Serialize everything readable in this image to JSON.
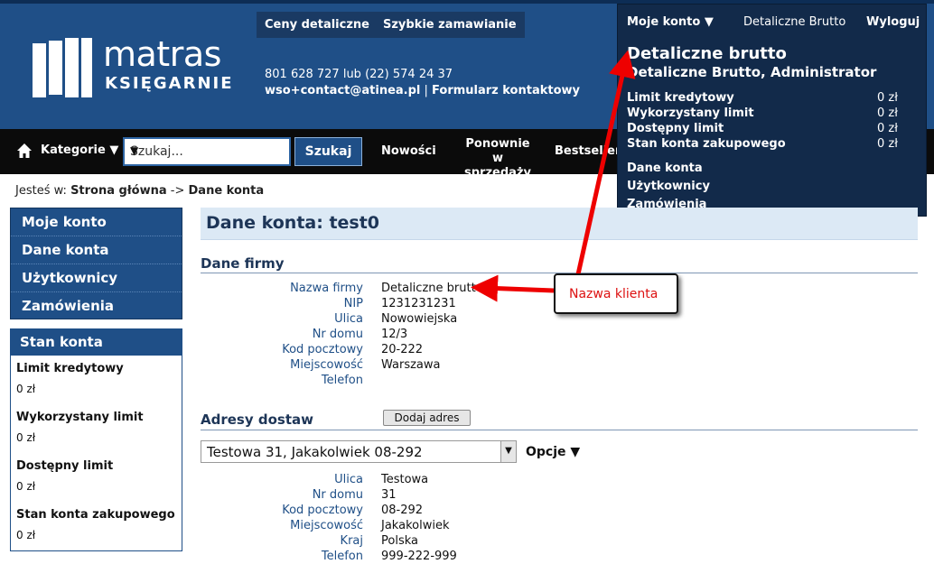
{
  "logo": {
    "brand": "matras",
    "sub": "KSIĘGARNIE"
  },
  "top_buttons": {
    "retail": "Ceny detaliczne",
    "quick": "Szybkie zamawianie"
  },
  "contact": {
    "phones": "801 628 727 lub (22) 574 24 37",
    "email": "wso+contact@atinea.pl",
    "separator": "|",
    "form": "Formularz kontaktowy"
  },
  "nav": {
    "categories": "Kategorie ▼",
    "search_placeholder": "Szukaj...",
    "search_button": "Szukaj",
    "new": "Nowości",
    "again_line1": "Ponownie",
    "again_line2": "w sprzedaży",
    "bestsellers": "Bestsellery"
  },
  "account": {
    "menu_label": "Moje konto ▼",
    "user_short": "Detaliczne Brutto",
    "logout": "Wyloguj",
    "company": "Detaliczne brutto",
    "role": "Detaliczne Brutto, Administrator",
    "rows": [
      {
        "label": "Limit kredytowy",
        "value": "0 zł"
      },
      {
        "label": "Wykorzystany limit",
        "value": "0 zł"
      },
      {
        "label": "Dostępny limit",
        "value": "0 zł"
      },
      {
        "label": "Stan konta zakupowego",
        "value": "0 zł"
      }
    ],
    "links": [
      "Dane konta",
      "Użytkownicy",
      "Zamówienia"
    ]
  },
  "breadcrumb": {
    "prefix": "Jesteś w:",
    "home": "Strona główna",
    "sep": "->",
    "current": "Dane konta"
  },
  "sidebar": {
    "items": [
      "Moje konto",
      "Dane konta",
      "Użytkownicy",
      "Zamówienia"
    ],
    "balance_title": "Stan konta",
    "balance": [
      {
        "label": "Limit kredytowy",
        "value": "0 zł"
      },
      {
        "label": "Wykorzystany limit",
        "value": "0 zł"
      },
      {
        "label": "Dostępny limit",
        "value": "0 zł"
      },
      {
        "label": "Stan konta zakupowego",
        "value": "0 zł"
      }
    ]
  },
  "main": {
    "title": "Dane konta: test0",
    "company_section": "Dane firmy",
    "company_fields": [
      {
        "label": "Nazwa firmy",
        "value": "Detaliczne brutto"
      },
      {
        "label": "NIP",
        "value": "1231231231"
      },
      {
        "label": "Ulica",
        "value": "Nowowiejska"
      },
      {
        "label": "Nr domu",
        "value": "12/3"
      },
      {
        "label": "Kod pocztowy",
        "value": "20-222"
      },
      {
        "label": "Miejscowość",
        "value": "Warszawa"
      },
      {
        "label": "Telefon",
        "value": ""
      }
    ],
    "address_section": "Adresy dostaw",
    "add_address": "Dodaj adres",
    "selected_address": "Testowa 31, Jakakolwiek 08-292",
    "options": "Opcje ▼",
    "address_fields": [
      {
        "label": "Ulica",
        "value": "Testowa"
      },
      {
        "label": "Nr domu",
        "value": "31"
      },
      {
        "label": "Kod pocztowy",
        "value": "08-292"
      },
      {
        "label": "Miejscowość",
        "value": "Jakakolwiek"
      },
      {
        "label": "Kraj",
        "value": "Polska"
      },
      {
        "label": "Telefon",
        "value": "999-222-999"
      }
    ]
  },
  "annotation": {
    "text": "Nazwa klienta",
    "color": "#dd1111"
  },
  "colors": {
    "header": "#1f4f87",
    "navbar": "#0b0b0b",
    "dropdown": "#122a4a",
    "label_blue": "#1f4f87"
  }
}
